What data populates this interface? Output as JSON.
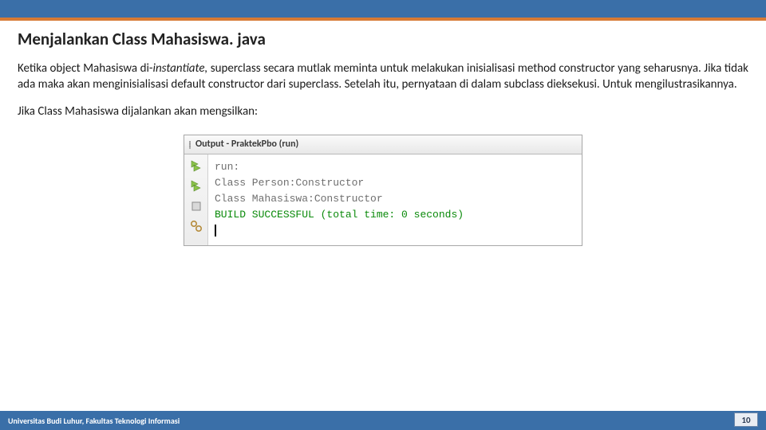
{
  "header": {
    "title": "Menjalankan Class Mahasiswa. java"
  },
  "paragraph": {
    "prefix": "Ketika object Mahasiswa di-",
    "italic": "instantiate,",
    "rest": " superclass secara mutlak meminta untuk melakukan inisialisasi method constructor yang seharusnya. Jika tidak ada maka akan menginisialisasi default constructor dari superclass. Setelah itu, pernyataan di dalam subclass dieksekusi. Untuk mengilustrasikannya."
  },
  "lead": "Jika Class Mahasiswa dijalankan akan mengsilkan:",
  "output": {
    "title": "Output - PraktekPbo (run)",
    "lines": [
      "run:",
      "Class Person:Constructor",
      "Class Mahasiswa:Constructor"
    ],
    "success": "BUILD SUCCESSFUL (total time: 0 seconds)"
  },
  "footer": {
    "text": "Universitas Budi Luhur, Fakultas Teknologi Informasi",
    "page": "10"
  }
}
